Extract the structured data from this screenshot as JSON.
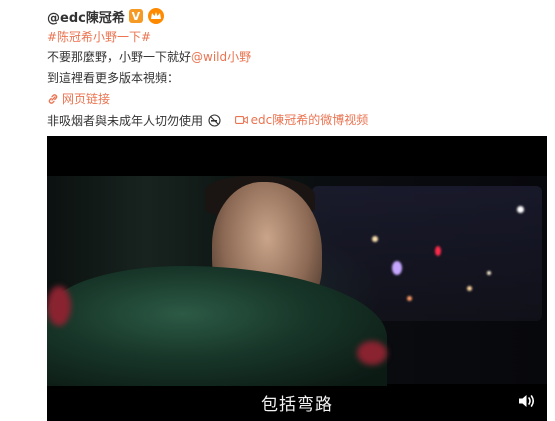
{
  "post": {
    "username": "@edc陳冠希",
    "verified_badge": "V",
    "hashtag": "#陈冠希小野一下#",
    "body_text_before_mention": "不要那麼野，小野一下就好",
    "mention": "@wild小野",
    "line3": "到這裡看更多版本視頻：",
    "web_link_label": "网页链接",
    "warning_text": "非吸烟者與未成年人切勿使用",
    "video_link_label": "edc陳冠希的微博视频"
  },
  "video": {
    "subtitle": "包括弯路"
  },
  "icons": {
    "verified": "verified-v-icon",
    "membership": "membership-crown-icon",
    "link": "link-icon",
    "no_smoking": "no-smoking-icon",
    "video": "video-camera-icon",
    "volume": "volume-icon"
  },
  "colors": {
    "accent": "#eb7350",
    "verified_badge": "#f59a23",
    "text": "#333333",
    "video_bg": "#000000"
  }
}
